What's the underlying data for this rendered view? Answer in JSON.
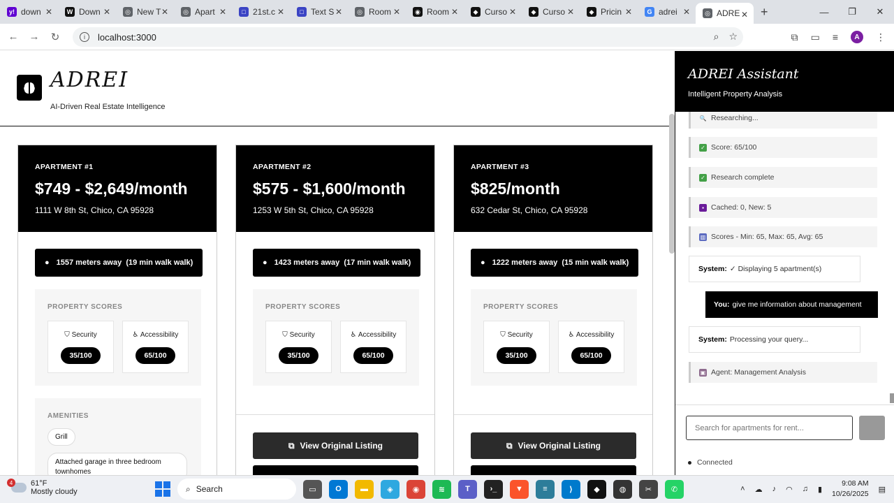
{
  "browser": {
    "tabs": [
      {
        "title": "down",
        "color": "#6001d2",
        "glyph": "y!"
      },
      {
        "title": "Down",
        "color": "#111111",
        "glyph": "W"
      },
      {
        "title": "New T",
        "color": "#5f6368",
        "glyph": "◎"
      },
      {
        "title": "Apart",
        "color": "#5f6368",
        "glyph": "◎"
      },
      {
        "title": "21st.c",
        "color": "#3b44c4",
        "glyph": "□"
      },
      {
        "title": "Text S",
        "color": "#3b44c4",
        "glyph": "□"
      },
      {
        "title": "Room",
        "color": "#5f6368",
        "glyph": "◎"
      },
      {
        "title": "Room",
        "color": "#111111",
        "glyph": "◉"
      },
      {
        "title": "Curso",
        "color": "#111111",
        "glyph": "◆"
      },
      {
        "title": "Curso",
        "color": "#111111",
        "glyph": "◆"
      },
      {
        "title": "Pricin",
        "color": "#111111",
        "glyph": "◆"
      },
      {
        "title": "adrei",
        "color": "#4285f4",
        "glyph": "G"
      },
      {
        "title": "ADRE",
        "color": "#5f6368",
        "glyph": "◎",
        "active": true
      }
    ],
    "url": "localhost:3000",
    "profile_initial": "A"
  },
  "header": {
    "title": "ADREI",
    "subtitle": "AI-Driven Real Estate Intelligence"
  },
  "listings": [
    {
      "label": "APARTMENT #1",
      "price": "$749 - $2,649/month",
      "address": "1111 W 8th St, Chico, CA 95928",
      "distance": "1557 meters away",
      "walk": "(19 min walk walk)",
      "scores_label": "PROPERTY SCORES",
      "security_label": "Security",
      "security_score": "35/100",
      "accessibility_label": "Accessibility",
      "accessibility_score": "65/100",
      "amenities_label": "AMENITIES",
      "amenities": [
        "Grill",
        "Attached garage in three bedroom townhomes"
      ]
    },
    {
      "label": "APARTMENT #2",
      "price": "$575 - $1,600/month",
      "address": "1253 W 5th St, Chico, CA 95928",
      "distance": "1423 meters away",
      "walk": "(17 min walk walk)",
      "scores_label": "PROPERTY SCORES",
      "security_label": "Security",
      "security_score": "35/100",
      "accessibility_label": "Accessibility",
      "accessibility_score": "65/100",
      "listing_button": "View Original Listing"
    },
    {
      "label": "APARTMENT #3",
      "price": "$825/month",
      "address": "632 Cedar St, Chico, CA 95928",
      "distance": "1222 meters away",
      "walk": "(15 min walk walk)",
      "scores_label": "PROPERTY SCORES",
      "security_label": "Security",
      "security_score": "35/100",
      "accessibility_label": "Accessibility",
      "accessibility_score": "65/100",
      "listing_button": "View Original Listing"
    }
  ],
  "assistant": {
    "title": "ADREI Assistant",
    "subtitle": "Intelligent Property Analysis",
    "status_researching": "Researching...",
    "status_score": "Score: 65/100",
    "status_complete": "Research complete",
    "status_cached": "Cached: 0, New: 5",
    "status_scores": "Scores - Min: 65, Max: 65, Avg: 65",
    "system_prefix": "System:",
    "system_msg1": "✓ Displaying 5 apartment(s)",
    "user_prefix": "You:",
    "user_msg": "give me information about management",
    "system_msg2": "Processing your query...",
    "status_agent": "Agent: Management Analysis",
    "input_placeholder": "Search for apartments for rent...",
    "connection": "Connected"
  },
  "taskbar": {
    "temperature": "61°F",
    "weather": "Mostly cloudy",
    "weather_badge": "4",
    "search": "Search",
    "time": "9:08 AM",
    "date": "10/26/2025"
  }
}
